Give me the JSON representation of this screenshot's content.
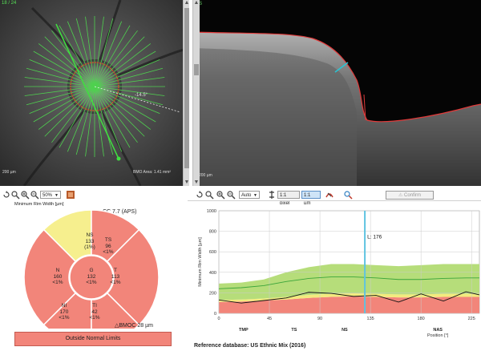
{
  "fundus": {
    "corner_label": "18 / 24",
    "angle_label": "-14.5°",
    "scale_bar": "200 µm",
    "area_text": "BMO Area: 1.41 mm²"
  },
  "bscan": {
    "corner_label": "S",
    "scale_bar": "200 µm"
  },
  "toolbar_left": {
    "zoom_value": "50%"
  },
  "toolbar_right": {
    "auto_label": "Auto",
    "pixel_btn": "1:1 pixel",
    "um_btn": "1:1 µm",
    "confirm_btn": "Confirm"
  },
  "sector_chart": {
    "title": "Minimum Rim Width [µm]",
    "cc_label": "CC 7.7 (APS)",
    "bmo_label": "BMOC 28 µm",
    "sectors": {
      "NS": {
        "name": "NS",
        "value": "133",
        "pct": "(1%)",
        "color": "#f6ef8e"
      },
      "TS": {
        "name": "TS",
        "value": "96",
        "pct": "<1%",
        "color": "#f2857a"
      },
      "N": {
        "name": "N",
        "value": "160",
        "pct": "<1%",
        "color": "#f2857a"
      },
      "T": {
        "name": "T",
        "value": "113",
        "pct": "<1%",
        "color": "#f2857a"
      },
      "NI": {
        "name": "NI",
        "value": "170",
        "pct": "<1%",
        "color": "#f2857a"
      },
      "TI": {
        "name": "TI",
        "value": "42",
        "pct": "<1%",
        "color": "#f2857a"
      },
      "G": {
        "name": "G",
        "value": "132",
        "pct": "<1%",
        "color": "#f2857a"
      }
    },
    "classification": "Outside Normal Limits",
    "classification_color": "#f2857a"
  },
  "reference_database": "Reference database: US Ethnic Mix (2016)",
  "chart_data": {
    "type": "line",
    "ylabel": "Minimum Rim Width [µm]",
    "xlabel": "Position [°]",
    "ylim": [
      0,
      1000
    ],
    "xlim": [
      0,
      232
    ],
    "yticks": [
      "1000",
      "800",
      "600",
      "400",
      "200",
      "0"
    ],
    "xticks": [
      "0",
      "45",
      "90",
      "135",
      "180",
      "225"
    ],
    "region_labels": [
      "TMP",
      "TS",
      "NS",
      "NAS"
    ],
    "region_positions": [
      22,
      67,
      112,
      195
    ],
    "cursor": {
      "x": 130,
      "label": "L: 176"
    },
    "x": [
      0,
      20,
      40,
      60,
      80,
      100,
      120,
      140,
      160,
      180,
      200,
      220,
      232
    ],
    "bands": {
      "green_top": [
        290,
        300,
        330,
        400,
        450,
        480,
        480,
        470,
        460,
        470,
        480,
        480,
        480
      ],
      "green_bottom": [
        180,
        185,
        195,
        215,
        240,
        250,
        255,
        250,
        245,
        245,
        250,
        250,
        250
      ],
      "yellow_bottom": [
        130,
        135,
        145,
        160,
        180,
        190,
        195,
        190,
        185,
        185,
        190,
        190,
        190
      ],
      "red_top": [
        110,
        115,
        125,
        135,
        150,
        160,
        165,
        160,
        155,
        155,
        160,
        160,
        160
      ]
    },
    "series": [
      {
        "name": "normal_mean",
        "color": "#3aa53a",
        "values": [
          240,
          250,
          270,
          310,
          340,
          355,
          355,
          345,
          330,
          330,
          340,
          345,
          345
        ]
      },
      {
        "name": "patient",
        "color": "#111111",
        "values": [
          130,
          100,
          125,
          150,
          205,
          195,
          165,
          175,
          110,
          190,
          120,
          210,
          180
        ]
      }
    ]
  }
}
